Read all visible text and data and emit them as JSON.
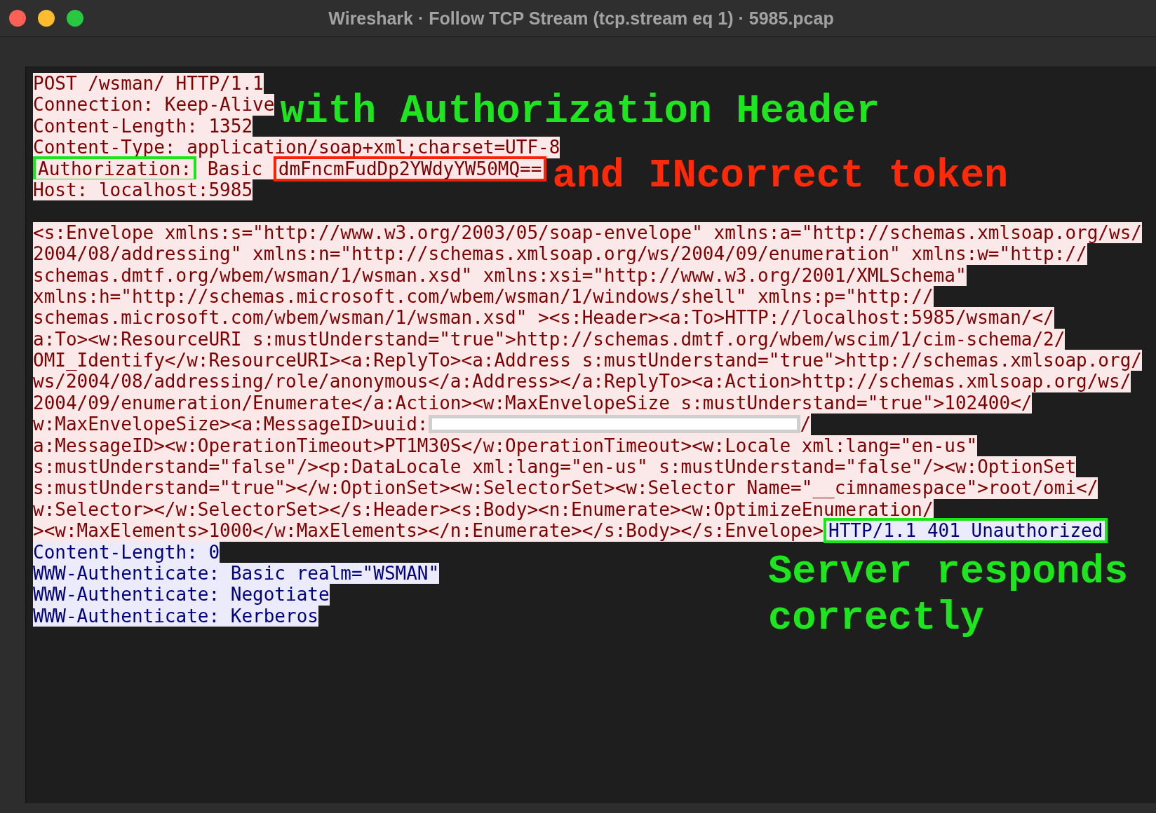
{
  "window": {
    "title": "Wireshark · Follow TCP Stream (tcp.stream eq 1) · 5985.pcap"
  },
  "stream": {
    "lines": [
      {
        "kind": "text",
        "segments": [
          {
            "text": "POST /wsman/ HTTP/1.1",
            "kind": "client"
          }
        ]
      },
      {
        "kind": "text",
        "segments": [
          {
            "text": "Connection: Keep-Alive",
            "kind": "client"
          }
        ],
        "note": {
          "text": "with Authorization Header",
          "color": "#1ee61e",
          "kind": "inline"
        }
      },
      {
        "kind": "text",
        "segments": [
          {
            "text": "Content-Length: 1352",
            "kind": "client"
          }
        ]
      },
      {
        "kind": "text",
        "segments": [
          {
            "text": "Content-Type: application/soap+xml;charset=UTF-8",
            "kind": "client"
          }
        ]
      },
      {
        "kind": "text",
        "segments": [
          {
            "text": "Authorization:",
            "kind": "client",
            "color": "#19e619"
          },
          {
            "text": " Basic ",
            "kind": "client"
          },
          {
            "text": "dmFncmFudDp2YWdyYW50MQ==",
            "kind": "client",
            "color": "#ff2200"
          }
        ],
        "note": {
          "text": "and INcorrect token",
          "color": "#ff2a0a",
          "kind": "inline"
        }
      },
      {
        "kind": "text",
        "segments": [
          {
            "text": "Host: localhost:5985",
            "kind": "client"
          }
        ]
      },
      {
        "kind": "blank"
      },
      {
        "kind": "text",
        "segments": [
          {
            "text": "<s:Envelope xmlns:s=\"http://www.w3.org/2003/05/soap-envelope\" xmlns:a=\"http://schemas.xmlsoap.org/ws/",
            "kind": "client"
          }
        ]
      },
      {
        "kind": "text",
        "segments": [
          {
            "text": "2004/08/addressing\" xmlns:n=\"http://schemas.xmlsoap.org/ws/2004/09/enumeration\" xmlns:w=\"http://",
            "kind": "client"
          }
        ]
      },
      {
        "kind": "text",
        "segments": [
          {
            "text": "schemas.dmtf.org/wbem/wsman/1/wsman.xsd\" xmlns:xsi=\"http://www.w3.org/2001/XMLSchema\"",
            "kind": "client"
          }
        ]
      },
      {
        "kind": "text",
        "segments": [
          {
            "text": "xmlns:h=\"http://schemas.microsoft.com/wbem/wsman/1/windows/shell\" xmlns:p=\"http://",
            "kind": "client"
          }
        ]
      },
      {
        "kind": "text",
        "segments": [
          {
            "text": "schemas.microsoft.com/wbem/wsman/1/wsman.xsd\" ><s:Header><a:To>HTTP://localhost:5985/wsman/</",
            "kind": "client"
          }
        ]
      },
      {
        "kind": "text",
        "segments": [
          {
            "text": "a:To><w:ResourceURI s:mustUnderstand=\"true\">http://schemas.dmtf.org/wbem/wscim/1/cim-schema/2/",
            "kind": "client"
          }
        ]
      },
      {
        "kind": "text",
        "segments": [
          {
            "text": "OMI_Identify</w:ResourceURI><a:ReplyTo><a:Address s:mustUnderstand=\"true\">http://schemas.xmlsoap.org/",
            "kind": "client"
          }
        ]
      },
      {
        "kind": "text",
        "segments": [
          {
            "text": "ws/2004/08/addressing/role/anonymous</a:Address></a:ReplyTo><a:Action>http://schemas.xmlsoap.org/ws/",
            "kind": "client"
          }
        ]
      },
      {
        "kind": "text",
        "segments": [
          {
            "text": "2004/09/enumeration/Enumerate</a:Action><w:MaxEnvelopeSize s:mustUnderstand=\"true\">102400</",
            "kind": "client"
          }
        ]
      },
      {
        "kind": "text",
        "segments": [
          {
            "text": "w:MaxEnvelopeSize><a:MessageID>uuid:",
            "kind": "client"
          },
          {
            "kind": "redacted"
          },
          {
            "text": "/",
            "kind": "client"
          }
        ]
      },
      {
        "kind": "text",
        "segments": [
          {
            "text": "a:MessageID><w:OperationTimeout>PT1M30S</w:OperationTimeout><w:Locale xml:lang=\"en-us\"",
            "kind": "client"
          }
        ]
      },
      {
        "kind": "text",
        "segments": [
          {
            "text": "s:mustUnderstand=\"false\"/><p:DataLocale xml:lang=\"en-us\" s:mustUnderstand=\"false\"/><w:OptionSet",
            "kind": "client"
          }
        ]
      },
      {
        "kind": "text",
        "segments": [
          {
            "text": "s:mustUnderstand=\"true\"></w:OptionSet><w:SelectorSet><w:Selector Name=\"__cimnamespace\">root/omi</",
            "kind": "client"
          }
        ]
      },
      {
        "kind": "text",
        "segments": [
          {
            "text": "w:Selector></w:SelectorSet></s:Header><s:Body><n:Enumerate><w:OptimizeEnumeration/",
            "kind": "client"
          }
        ]
      },
      {
        "kind": "text",
        "segments": [
          {
            "text": "><w:MaxElements>1000</w:MaxElements></n:Enumerate></s:Body></s:Envelope>",
            "kind": "client"
          },
          {
            "text": "HTTP/1.1 401 Unauthorized",
            "kind": "server",
            "color": "#19e619"
          }
        ]
      },
      {
        "kind": "text",
        "segments": [
          {
            "text": "Content-Length: 0",
            "kind": "server"
          }
        ],
        "note": {
          "text": "Server responds correctly",
          "color": "#1ee61e",
          "kind": "aside"
        }
      },
      {
        "kind": "text",
        "segments": [
          {
            "text": "WWW-Authenticate: Basic realm=\"WSMAN\"",
            "kind": "server"
          }
        ]
      },
      {
        "kind": "text",
        "segments": [
          {
            "text": "WWW-Authenticate: Negotiate",
            "kind": "server"
          }
        ]
      },
      {
        "kind": "text",
        "segments": [
          {
            "text": "WWW-Authenticate: Kerberos",
            "kind": "server"
          }
        ]
      }
    ]
  }
}
